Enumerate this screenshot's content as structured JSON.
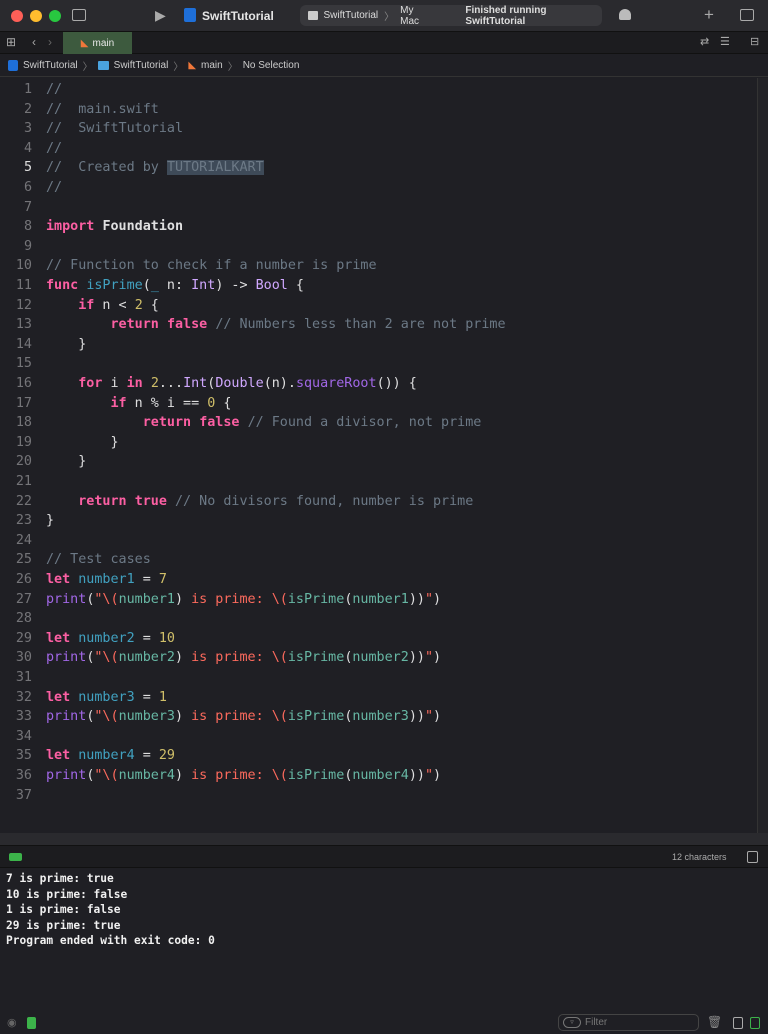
{
  "window": {
    "title": "SwiftTutorial",
    "scheme": "SwiftTutorial",
    "destination": "My Mac",
    "status": "Finished running SwiftTutorial"
  },
  "tab": {
    "label": "main"
  },
  "breadcrumb": [
    "SwiftTutorial",
    "SwiftTutorial",
    "main",
    "No Selection"
  ],
  "colors": {
    "keyword": "#fc5fa3",
    "type": "#d0a8ff",
    "number": "#d0bf69",
    "comment": "#6c7986",
    "string": "#fc6a5d"
  },
  "current_line": 5,
  "code": [
    [
      [
        "cm",
        "//"
      ]
    ],
    [
      [
        "cm",
        "//  main.swift"
      ]
    ],
    [
      [
        "cm",
        "//  SwiftTutorial"
      ]
    ],
    [
      [
        "cm",
        "//"
      ]
    ],
    [
      [
        "cm",
        "//  Created by "
      ],
      [
        "hl",
        "TUTORIALKART"
      ]
    ],
    [
      [
        "cm",
        "//"
      ]
    ],
    [],
    [
      [
        "kw",
        "import"
      ],
      [
        "pl",
        " "
      ],
      [
        "pl bold",
        "Foundation"
      ]
    ],
    [],
    [
      [
        "cm",
        "// Function to check if a number is prime"
      ]
    ],
    [
      [
        "kw",
        "func"
      ],
      [
        "pl",
        " "
      ],
      [
        "fn",
        "isPrime"
      ],
      [
        "pl",
        "("
      ],
      [
        "fn",
        "_"
      ],
      [
        "pl",
        " n: "
      ],
      [
        "ty",
        "Int"
      ],
      [
        "pl",
        ") -> "
      ],
      [
        "ty",
        "Bool"
      ],
      [
        "pl",
        " {"
      ]
    ],
    [
      [
        "pl",
        "    "
      ],
      [
        "kw",
        "if"
      ],
      [
        "pl",
        " n < "
      ],
      [
        "num",
        "2"
      ],
      [
        "pl",
        " {"
      ]
    ],
    [
      [
        "pl",
        "        "
      ],
      [
        "kw",
        "return"
      ],
      [
        "pl",
        " "
      ],
      [
        "kw",
        "false"
      ],
      [
        "pl",
        " "
      ],
      [
        "cm",
        "// Numbers less than 2 are not prime"
      ]
    ],
    [
      [
        "pl",
        "    }"
      ]
    ],
    [],
    [
      [
        "pl",
        "    "
      ],
      [
        "kw",
        "for"
      ],
      [
        "pl",
        " i "
      ],
      [
        "kw",
        "in"
      ],
      [
        "pl",
        " "
      ],
      [
        "num",
        "2"
      ],
      [
        "pl",
        "..."
      ],
      [
        "ty",
        "Int"
      ],
      [
        "pl",
        "("
      ],
      [
        "ty",
        "Double"
      ],
      [
        "pl",
        "(n)."
      ],
      [
        "mt",
        "squareRoot"
      ],
      [
        "pl",
        "()) {"
      ]
    ],
    [
      [
        "pl",
        "        "
      ],
      [
        "kw",
        "if"
      ],
      [
        "pl",
        " n % i == "
      ],
      [
        "num",
        "0"
      ],
      [
        "pl",
        " {"
      ]
    ],
    [
      [
        "pl",
        "            "
      ],
      [
        "kw",
        "return"
      ],
      [
        "pl",
        " "
      ],
      [
        "kw",
        "false"
      ],
      [
        "pl",
        " "
      ],
      [
        "cm",
        "// Found a divisor, not prime"
      ]
    ],
    [
      [
        "pl",
        "        }"
      ]
    ],
    [
      [
        "pl",
        "    }"
      ]
    ],
    [],
    [
      [
        "pl",
        "    "
      ],
      [
        "kw",
        "return"
      ],
      [
        "pl",
        " "
      ],
      [
        "kw",
        "true"
      ],
      [
        "pl",
        " "
      ],
      [
        "cm",
        "// No divisors found, number is prime"
      ]
    ],
    [
      [
        "pl",
        "}"
      ]
    ],
    [],
    [
      [
        "cm",
        "// Test cases"
      ]
    ],
    [
      [
        "kw",
        "let"
      ],
      [
        "pl",
        " "
      ],
      [
        "fn",
        "number1"
      ],
      [
        "pl",
        " = "
      ],
      [
        "num",
        "7"
      ]
    ],
    [
      [
        "mt",
        "print"
      ],
      [
        "pl",
        "("
      ],
      [
        "str",
        "\"\\("
      ],
      [
        "pj",
        "number1"
      ],
      [
        "pl",
        ")"
      ],
      [
        "str",
        " is prime: \\("
      ],
      [
        "pj",
        "isPrime"
      ],
      [
        "pl",
        "("
      ],
      [
        "pj",
        "number1"
      ],
      [
        "pl",
        "))"
      ],
      [
        "str",
        "\""
      ],
      [
        "pl",
        ")"
      ]
    ],
    [],
    [
      [
        "kw",
        "let"
      ],
      [
        "pl",
        " "
      ],
      [
        "fn",
        "number2"
      ],
      [
        "pl",
        " = "
      ],
      [
        "num",
        "10"
      ]
    ],
    [
      [
        "mt",
        "print"
      ],
      [
        "pl",
        "("
      ],
      [
        "str",
        "\"\\("
      ],
      [
        "pj",
        "number2"
      ],
      [
        "pl",
        ")"
      ],
      [
        "str",
        " is prime: \\("
      ],
      [
        "pj",
        "isPrime"
      ],
      [
        "pl",
        "("
      ],
      [
        "pj",
        "number2"
      ],
      [
        "pl",
        "))"
      ],
      [
        "str",
        "\""
      ],
      [
        "pl",
        ")"
      ]
    ],
    [],
    [
      [
        "kw",
        "let"
      ],
      [
        "pl",
        " "
      ],
      [
        "fn",
        "number3"
      ],
      [
        "pl",
        " = "
      ],
      [
        "num",
        "1"
      ]
    ],
    [
      [
        "mt",
        "print"
      ],
      [
        "pl",
        "("
      ],
      [
        "str",
        "\"\\("
      ],
      [
        "pj",
        "number3"
      ],
      [
        "pl",
        ")"
      ],
      [
        "str",
        " is prime: \\("
      ],
      [
        "pj",
        "isPrime"
      ],
      [
        "pl",
        "("
      ],
      [
        "pj",
        "number3"
      ],
      [
        "pl",
        "))"
      ],
      [
        "str",
        "\""
      ],
      [
        "pl",
        ")"
      ]
    ],
    [],
    [
      [
        "kw",
        "let"
      ],
      [
        "pl",
        " "
      ],
      [
        "fn",
        "number4"
      ],
      [
        "pl",
        " = "
      ],
      [
        "num",
        "29"
      ]
    ],
    [
      [
        "mt",
        "print"
      ],
      [
        "pl",
        "("
      ],
      [
        "str",
        "\"\\("
      ],
      [
        "pj",
        "number4"
      ],
      [
        "pl",
        ")"
      ],
      [
        "str",
        " is prime: \\("
      ],
      [
        "pj",
        "isPrime"
      ],
      [
        "pl",
        "("
      ],
      [
        "pj",
        "number4"
      ],
      [
        "pl",
        "))"
      ],
      [
        "str",
        "\""
      ],
      [
        "pl",
        ")"
      ]
    ],
    []
  ],
  "debug": {
    "selection_count": "12 characters"
  },
  "console": [
    "7 is prime: true",
    "10 is prime: false",
    "1 is prime: false",
    "29 is prime: true",
    "Program ended with exit code: 0"
  ],
  "filter": {
    "placeholder": "Filter"
  }
}
